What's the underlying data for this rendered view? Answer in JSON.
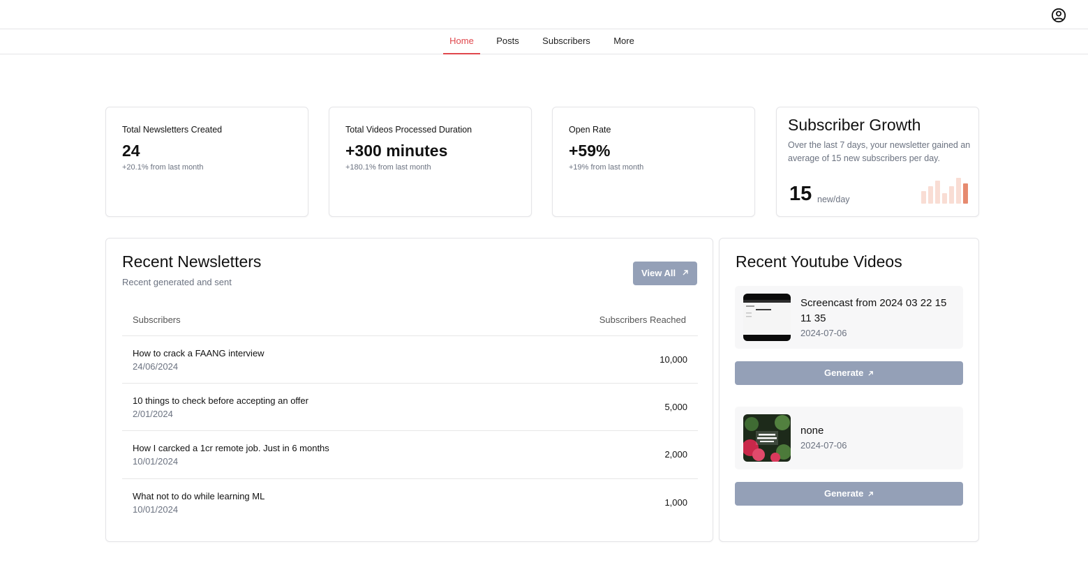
{
  "header": {
    "user_icon": "user-circle-icon"
  },
  "nav": {
    "items": [
      "Home",
      "Posts",
      "Subscribers",
      "More"
    ],
    "active": "Home",
    "accent_color": "#e0474c"
  },
  "stats": [
    {
      "label": "Total Newsletters Created",
      "value": "24",
      "change": "+20.1% from last month"
    },
    {
      "label": "Total Videos Processed Duration",
      "value": "+300 minutes",
      "change": "+180.1% from last month"
    },
    {
      "label": "Open Rate",
      "value": "+59%",
      "change": "+19% from last month"
    }
  ],
  "growth": {
    "title": "Subscriber Growth",
    "description": "Over the last 7 days, your newsletter gained an average of 15 new subscribers per day.",
    "value": "15",
    "unit": "new/day",
    "bar_levels": [
      0.45,
      0.62,
      0.82,
      0.38,
      0.62,
      0.92,
      0.72
    ],
    "bar_colors": [
      "#f9ddd4",
      "#f9ddd4",
      "#f9ddd4",
      "#f9ddd4",
      "#f9ddd4",
      "#f9ddd4",
      "#e68a6f"
    ]
  },
  "newsletters": {
    "title": "Recent Newsletters",
    "subtitle": "Recent generated and sent",
    "view_all": "View All",
    "columns": [
      "Subscribers",
      "Subscribers Reached"
    ],
    "rows": [
      {
        "title": "How to crack a FAANG interview",
        "date": "24/06/2024",
        "reached": "10,000"
      },
      {
        "title": "10 things to check before accepting an offer",
        "date": "2/01/2024",
        "reached": "5,000"
      },
      {
        "title": "How I carcked a 1cr remote job. Just in 6 months",
        "date": "10/01/2024",
        "reached": "2,000"
      },
      {
        "title": "What not to do while learning ML",
        "date": "10/01/2024",
        "reached": "1,000"
      }
    ]
  },
  "videos": {
    "title": "Recent Youtube Videos",
    "generate_label": "Generate",
    "button_color": "#94a0b7",
    "items": [
      {
        "title": "Screencast from 2024 03 22 15 11 35",
        "date": "2024-07-06"
      },
      {
        "title": "none",
        "date": "2024-07-06"
      }
    ]
  }
}
